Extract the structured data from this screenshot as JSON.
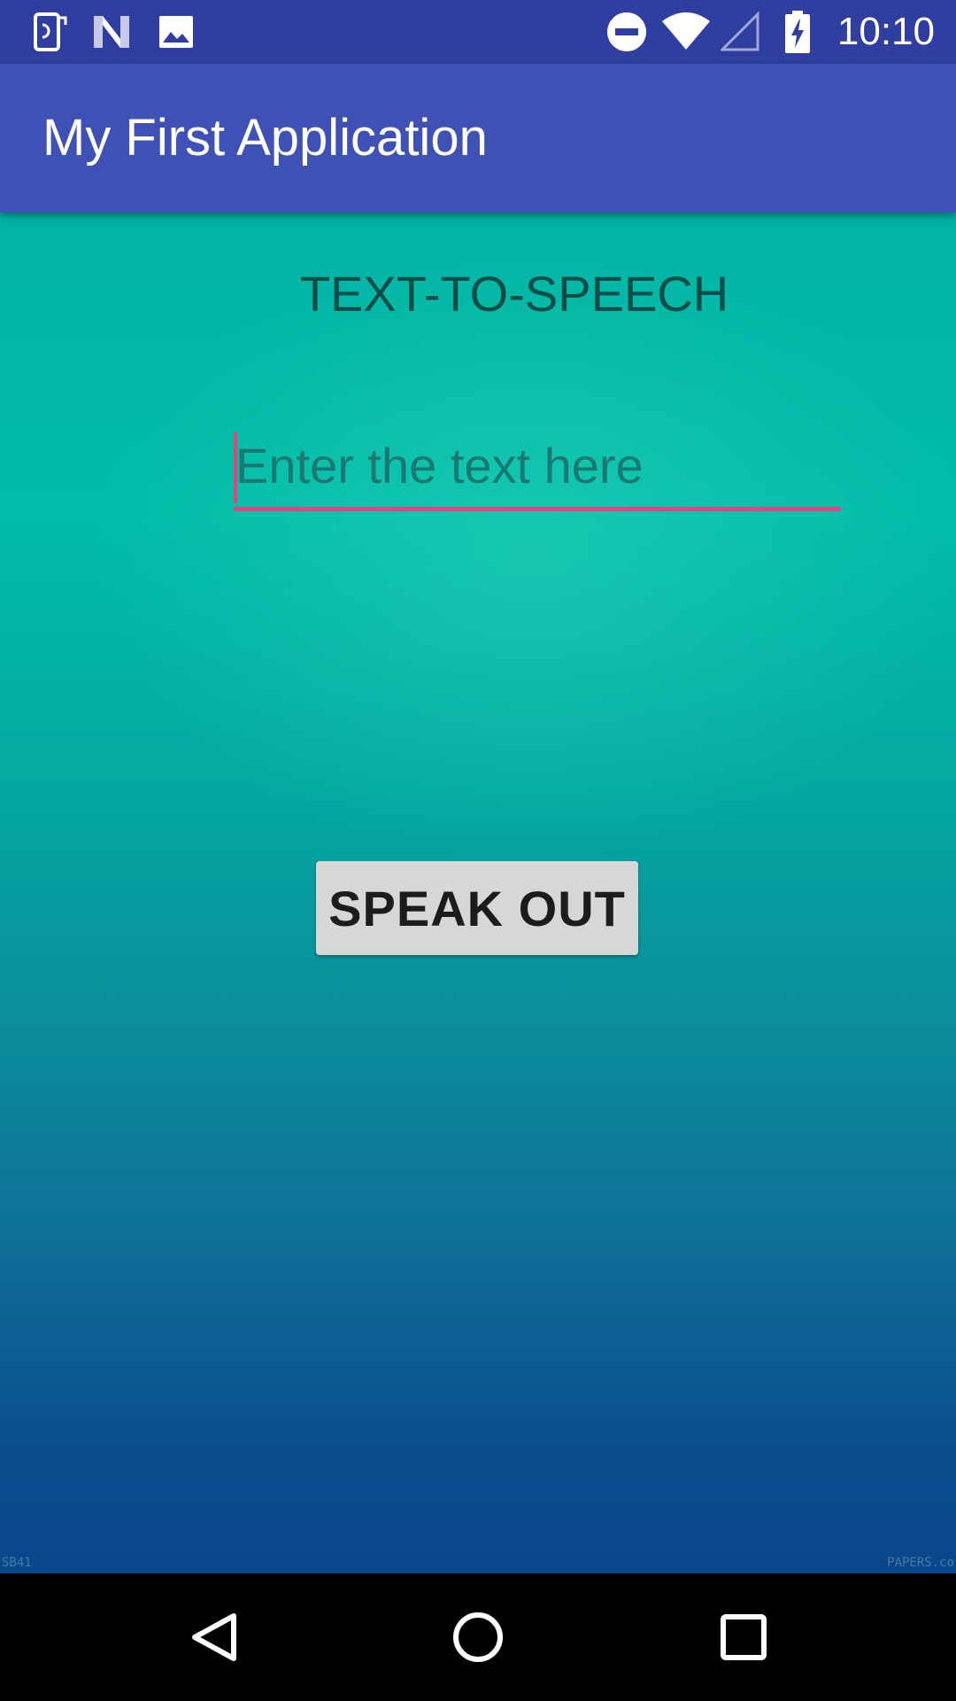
{
  "status_bar": {
    "time": "10:10",
    "icons": [
      "phone-rotate-icon",
      "n-logo-icon",
      "image-icon",
      "do-not-disturb-icon",
      "wifi-icon",
      "cell-signal-icon",
      "battery-charging-icon"
    ]
  },
  "app_bar": {
    "title": "My First Application"
  },
  "content": {
    "heading": "TEXT-TO-SPEECH",
    "input": {
      "value": "",
      "placeholder": "Enter the text here"
    },
    "speak_button_label": "SPEAK OUT",
    "watermark_left": "SB41",
    "watermark_right": "PAPERS.co"
  },
  "nav_bar": {
    "buttons": [
      "back-icon",
      "home-icon",
      "recents-icon"
    ]
  },
  "colors": {
    "status_bar": "#303f9f",
    "app_bar": "#3f51b5",
    "accent": "#e0457b",
    "button": "#d6d7d7"
  }
}
